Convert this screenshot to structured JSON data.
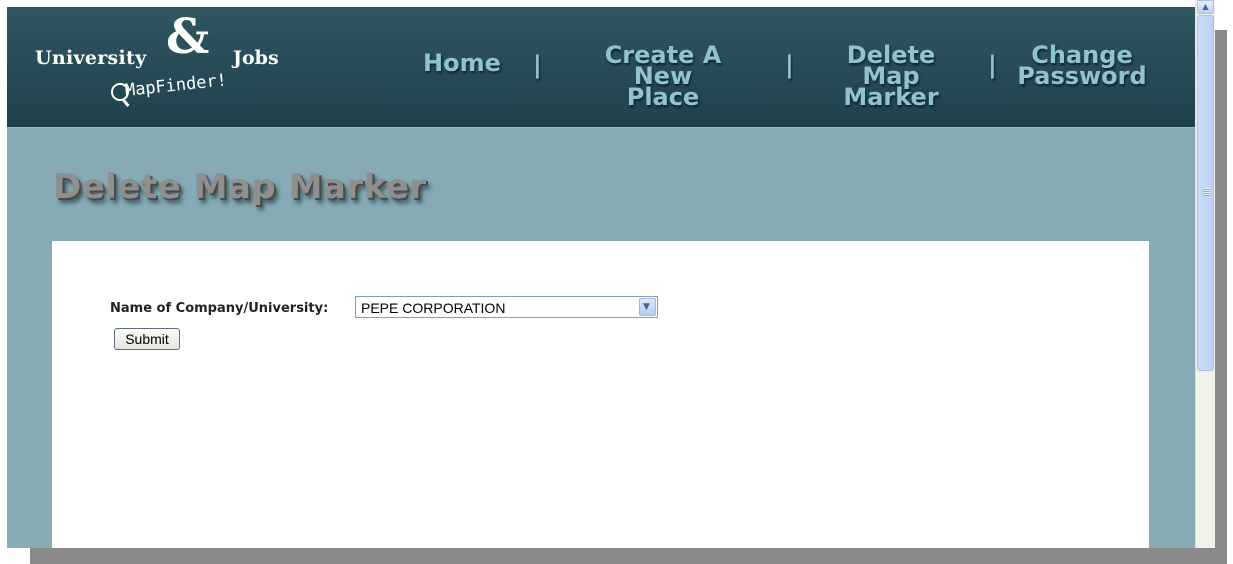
{
  "logo": {
    "word_left": "University",
    "ampersand": "&",
    "word_right": "Jobs",
    "tagline": "MapFinder!"
  },
  "nav": {
    "home": "Home",
    "create_line1": "Create A New",
    "create_line2": "Place",
    "delete_line1": "Delete Map",
    "delete_line2": "Marker",
    "change_line1": "Change",
    "change_line2": "Password",
    "separator": "|"
  },
  "page": {
    "title": "Delete Map Marker"
  },
  "form": {
    "label": "Name of Company/University:",
    "selected": "PEPE CORPORATION",
    "submit_label": "Submit"
  },
  "colors": {
    "header": "#2a4e59",
    "body": "#86abb5",
    "nav_text": "#8fc3cf",
    "content": "#ffffff"
  }
}
